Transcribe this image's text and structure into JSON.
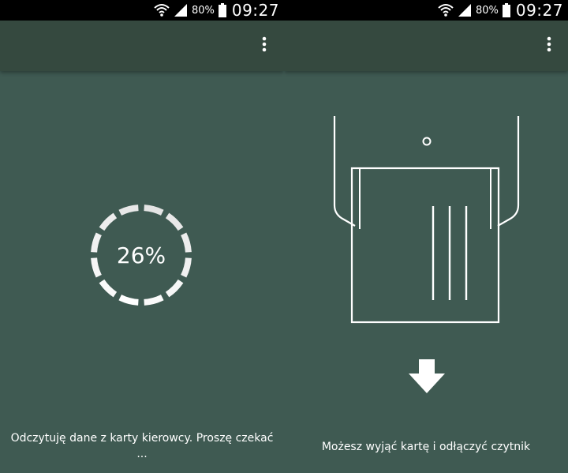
{
  "status_bar": {
    "battery_percent": "80%",
    "time": "09:27"
  },
  "left_screen": {
    "menu_icon": "more-vert-icon",
    "progress": {
      "percent": 26,
      "label": "26%"
    },
    "message_line1": "Odczytuję dane z karty kierowcy. Proszę czekać",
    "message_line2": "..."
  },
  "right_screen": {
    "menu_icon": "more-vert-icon",
    "illustration": "card-reader-icon",
    "arrow_icon": "arrow-down-icon",
    "message": "Możesz wyjąć kartę i odłączyć czytnik"
  },
  "colors": {
    "background": "#3f5a52",
    "app_bar": "#35493f",
    "status_bar": "#000000",
    "foreground": "#ffffff"
  }
}
